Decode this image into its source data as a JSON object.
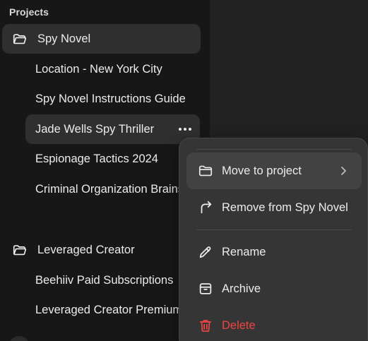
{
  "sidebar": {
    "heading": "Projects",
    "projects": [
      {
        "name": "Spy Novel",
        "icon": "folder-open-icon",
        "chats": [
          "Location - New York City",
          "Spy Novel Instructions Guide",
          "Jade Wells Spy Thriller",
          "Espionage Tactics 2024",
          "Criminal Organization Brainstorm"
        ]
      },
      {
        "name": "Leveraged Creator",
        "icon": "folder-open-icon",
        "chats": [
          "Beehiiv Paid Subscriptions",
          "Leveraged Creator Premium"
        ]
      }
    ],
    "more_icon": "ellipsis-icon"
  },
  "context_menu": {
    "items": [
      {
        "label": "Move to project",
        "icon": "folder-icon",
        "has_submenu": true
      },
      {
        "label": "Remove from Spy Novel",
        "icon": "undo-arrow-icon"
      },
      {
        "label": "Rename",
        "icon": "pencil-icon"
      },
      {
        "label": "Archive",
        "icon": "archive-box-icon"
      },
      {
        "label": "Delete",
        "icon": "trash-icon",
        "danger": true
      }
    ]
  },
  "colors": {
    "sidebar_bg": "#171717",
    "main_bg": "#212121",
    "selected_row": "#2f2f2f",
    "menu_bg": "#353535",
    "menu_highlight": "#424242",
    "danger": "#ef4444",
    "text": "#ececec"
  }
}
